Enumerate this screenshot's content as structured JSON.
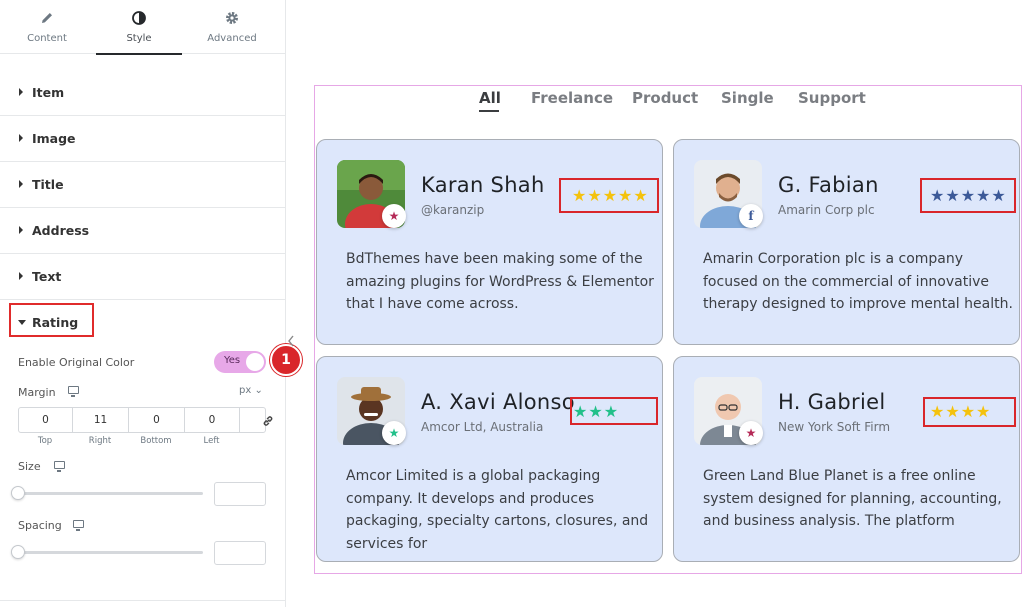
{
  "editor": {
    "tabs": [
      {
        "label": "Content",
        "icon": "pencil-icon"
      },
      {
        "label": "Style",
        "icon": "half-circle-icon"
      },
      {
        "label": "Advanced",
        "icon": "gear-icon"
      }
    ],
    "sections": [
      {
        "label": "Item"
      },
      {
        "label": "Image"
      },
      {
        "label": "Title"
      },
      {
        "label": "Address"
      },
      {
        "label": "Text"
      },
      {
        "label": "Rating"
      }
    ],
    "rating": {
      "enable_original_color_label": "Enable Original Color",
      "toggle_value": "Yes",
      "step_badge": "1",
      "margin_label": "Margin",
      "unit": "px",
      "margin": [
        {
          "value": "0",
          "label": "Top"
        },
        {
          "value": "11",
          "label": "Right"
        },
        {
          "value": "0",
          "label": "Bottom"
        },
        {
          "value": "0",
          "label": "Left"
        }
      ],
      "size_label": "Size",
      "spacing_label": "Spacing"
    }
  },
  "preview": {
    "filters": [
      "All",
      "Freelance",
      "Product",
      "Single",
      "Support"
    ],
    "active_filter": "All",
    "cards": [
      {
        "name": "Karan Shah",
        "handle": "@karanzip",
        "text": "BdThemes have been making some of the amazing plugins for WordPress & Elementor that I have come across.",
        "stars": "★★★★★",
        "rating": 5,
        "star_color": "#f4c20d",
        "badge_icon": "star-icon",
        "badge_glyph": "★",
        "badge_color": "#b52a57"
      },
      {
        "name": "G. Fabian",
        "handle": "Amarin Corp plc",
        "text": "Amarin Corporation plc is a company focused on the commercial of innovative therapy designed to improve mental health.",
        "stars": "★★★★★",
        "rating": 5,
        "star_color": "#3b5998",
        "badge_icon": "facebook-icon",
        "badge_glyph": "f",
        "badge_color": "#3b5998"
      },
      {
        "name": "A. Xavi Alonso",
        "handle": "Amcor Ltd, Australia",
        "text": "Amcor Limited is a global packaging company. It develops and produces packaging, specialty cartons, closures, and services for",
        "stars": "★★★",
        "rating": 3,
        "star_color": "#22c08a",
        "badge_icon": "star-icon",
        "badge_glyph": "★",
        "badge_color": "#22c08a"
      },
      {
        "name": "H. Gabriel",
        "handle": "New York Soft Firm",
        "text": "Green Land Blue Planet is a free online system designed for planning, accounting, and business analysis. The platform",
        "stars": "★★★★",
        "rating": 4,
        "star_color": "#f4c20d",
        "badge_icon": "star-icon",
        "badge_glyph": "★",
        "badge_color": "#b52a57"
      }
    ]
  }
}
